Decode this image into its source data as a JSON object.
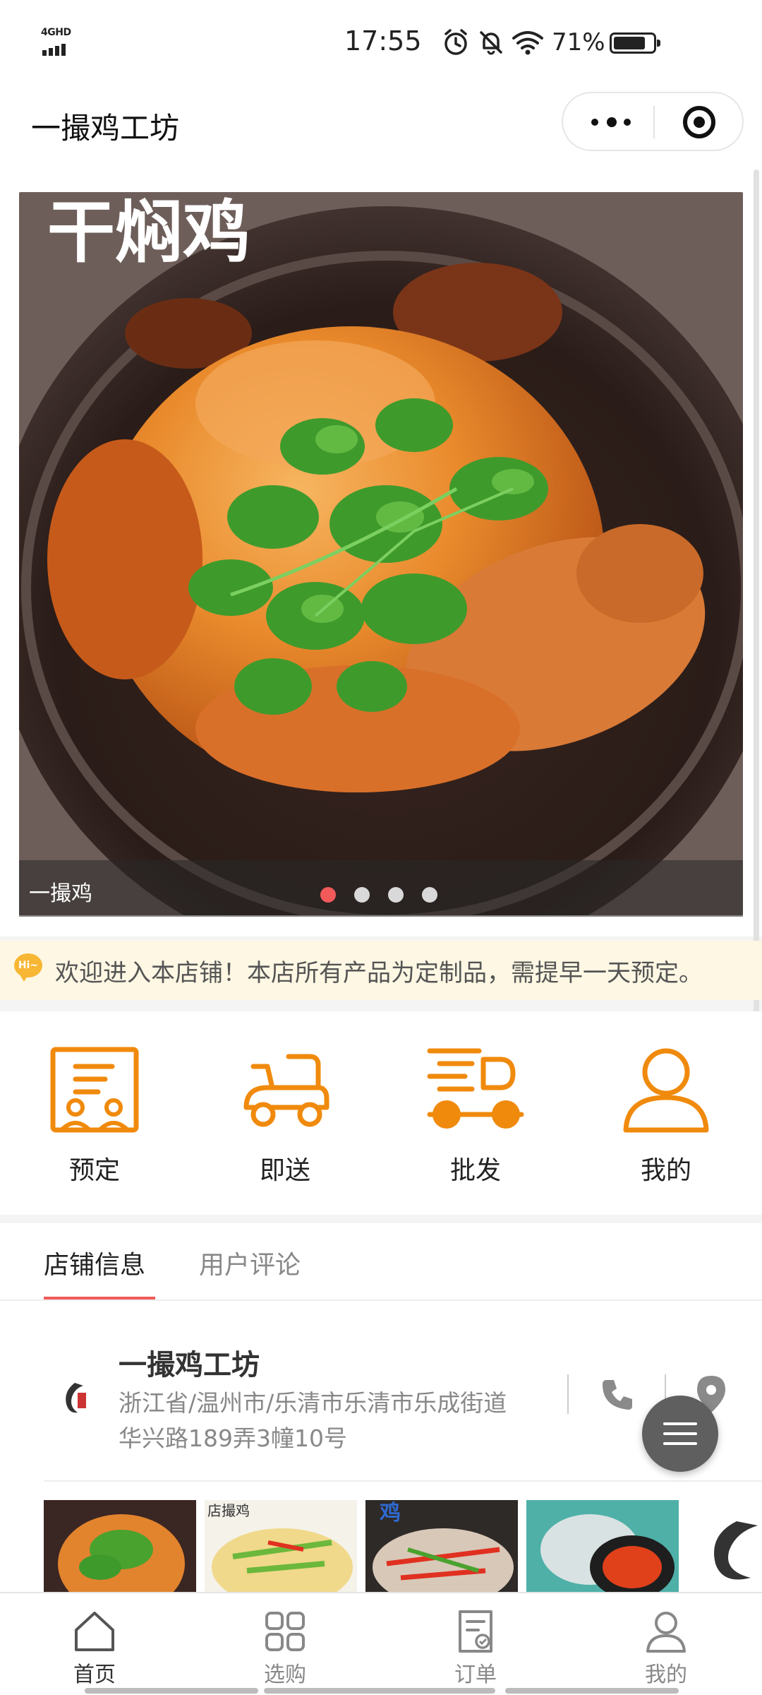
{
  "status_bar": {
    "network": "4GHD",
    "time": "17:55",
    "battery": "71%",
    "icons": [
      "signal-icon",
      "alarm-icon",
      "mute-icon",
      "wifi-icon",
      "battery-icon"
    ]
  },
  "nav": {
    "title": "一撮鸡工坊",
    "icons": [
      "more-icon",
      "close-target-icon"
    ]
  },
  "banner": {
    "image_title": "干焖鸡",
    "caption": "一撮鸡",
    "slide_count": 4,
    "active_slide": 1,
    "active_color": "#f25a5a"
  },
  "notice": {
    "icon_text": "Hi~",
    "text": "欢迎进入本店铺！本店所有产品为定制品，需提早一天预定。"
  },
  "quick_menu": [
    {
      "label": "预定",
      "icon": "reserve-icon"
    },
    {
      "label": "即送",
      "icon": "scooter-icon"
    },
    {
      "label": "批发",
      "icon": "delivery-truck-icon"
    },
    {
      "label": "我的",
      "icon": "user-icon"
    }
  ],
  "accent_color": "#f08a0c",
  "tabs": [
    {
      "label": "店铺信息",
      "active": true
    },
    {
      "label": "用户评论",
      "active": false
    }
  ],
  "store": {
    "name": "一撮鸡工坊",
    "address_line1": "浙江省/温州市/乐清市乐清市乐成街道",
    "address_line2": "华兴路189弄3幢10号",
    "thumb_texts": [
      "店撮鸡",
      "鸡"
    ]
  },
  "tabbar": [
    {
      "label": "首页",
      "icon": "home-icon",
      "active": true
    },
    {
      "label": "选购",
      "icon": "grid-icon",
      "active": false
    },
    {
      "label": "订单",
      "icon": "order-icon",
      "active": false
    },
    {
      "label": "我的",
      "icon": "profile-icon",
      "active": false
    }
  ]
}
